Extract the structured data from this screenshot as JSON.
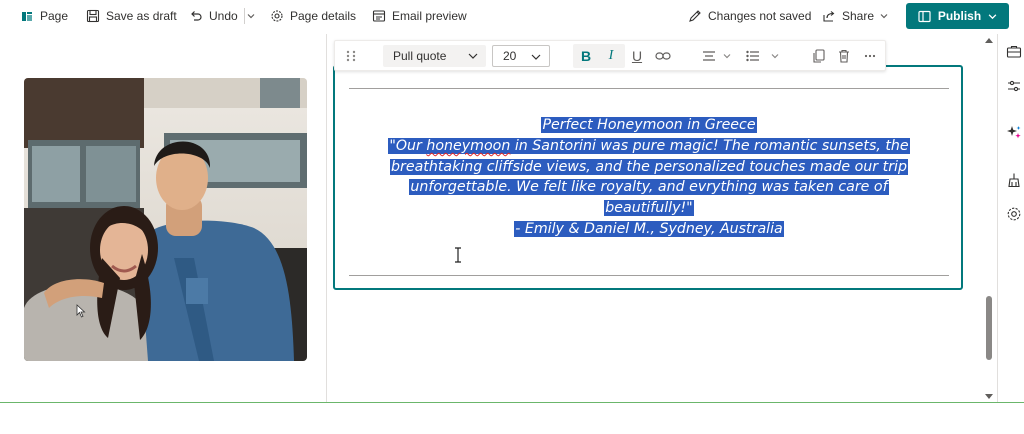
{
  "command_bar": {
    "page_label": "Page",
    "save_draft_label": "Save as draft",
    "undo_label": "Undo",
    "page_details_label": "Page details",
    "email_preview_label": "Email preview",
    "changes_status": "Changes not saved",
    "share_label": "Share",
    "publish_label": "Publish"
  },
  "format_toolbar": {
    "text_style": "Pull quote",
    "font_size": "20",
    "bold_glyph": "B",
    "italic_glyph": "I",
    "underline_glyph": "U"
  },
  "pull_quote": {
    "title": "Perfect Honeymoon in Greece",
    "quote_open": "\"Our ",
    "quote_misspelled": "honeymoon",
    "quote_line1_rest": " in Santorini was pure magic! The romantic sunsets, the",
    "quote_line2": "breathtaking cliffside views, and the personalized touches made our trip",
    "quote_line3": "unforgettable. We felt like royalty, and evrything was taken care of",
    "quote_line4": "beautifully!\"",
    "attribution": "- Emily & Daniel M., Sydney, Australia"
  },
  "photo": {
    "alt": "couple-photo"
  },
  "colors": {
    "accent": "#03787c",
    "selection": "#2c5cbf"
  },
  "icons": [
    "page-icon",
    "save-icon",
    "undo-icon",
    "gear-icon",
    "email-preview-icon",
    "pencil-icon",
    "share-icon",
    "publish-icon",
    "chevron-down-icon",
    "grip-icon",
    "link-icon",
    "align-icon",
    "list-icon",
    "duplicate-icon",
    "trash-icon",
    "more-icon",
    "toolbox-icon",
    "sliders-icon",
    "design-ideas-icon",
    "broom-icon",
    "settings-icon"
  ]
}
